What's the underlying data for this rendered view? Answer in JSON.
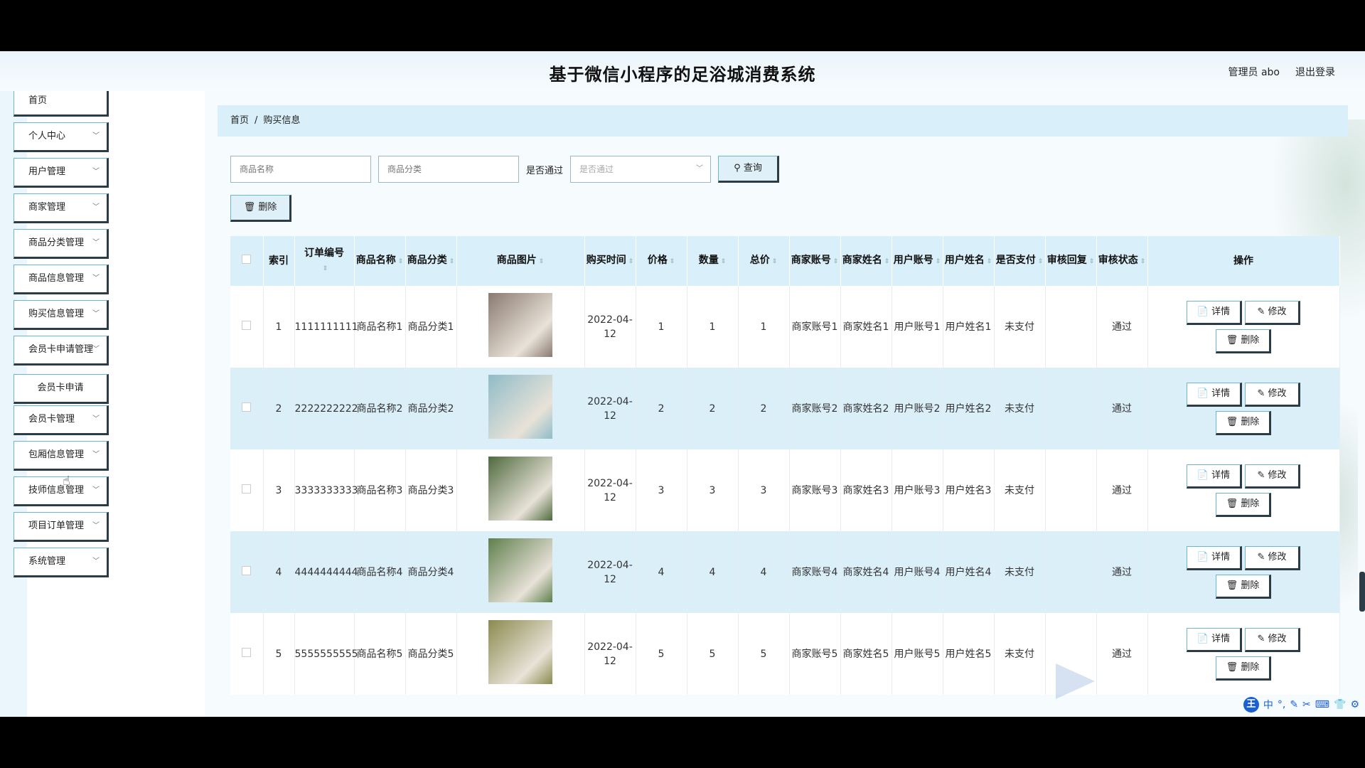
{
  "app": {
    "title": "基于微信小程序的足浴城消费系统",
    "admin_label": "管理员 abo",
    "logout_label": "退出登录"
  },
  "sidebar": {
    "items": [
      {
        "label": "首页",
        "chevron": false
      },
      {
        "label": "个人中心",
        "chevron": true
      },
      {
        "label": "用户管理",
        "chevron": true
      },
      {
        "label": "商家管理",
        "chevron": true
      },
      {
        "label": "商品分类管理",
        "chevron": true
      },
      {
        "label": "商品信息管理",
        "chevron": true
      },
      {
        "label": "购买信息管理",
        "chevron": true
      },
      {
        "label": "会员卡申请管理",
        "chevron": true
      },
      {
        "label": "会员卡申请",
        "chevron": false,
        "sub": true
      },
      {
        "label": "会员卡管理",
        "chevron": true
      },
      {
        "label": "包厢信息管理",
        "chevron": true
      },
      {
        "label": "技师信息管理",
        "chevron": true
      },
      {
        "label": "项目订单管理",
        "chevron": true
      },
      {
        "label": "系统管理",
        "chevron": true
      }
    ]
  },
  "breadcrumb": {
    "home": "首页",
    "separator": "/",
    "current": "购买信息"
  },
  "search": {
    "product_name_placeholder": "商品名称",
    "product_category_placeholder": "商品分类",
    "approved_label": "是否通过",
    "approved_select_placeholder": "是否通过",
    "query_label": "查询",
    "delete_label": "删除"
  },
  "table": {
    "headers": {
      "index": "索引",
      "order_no": "订单编号",
      "product_name": "商品名称",
      "product_category": "商品分类",
      "product_image": "商品图片",
      "purchase_time": "购买时间",
      "price": "价格",
      "quantity": "数量",
      "total": "总价",
      "merchant_account": "商家账号",
      "merchant_name": "商家姓名",
      "user_account": "用户账号",
      "user_name": "用户姓名",
      "paid": "是否支付",
      "review_reply": "审核回复",
      "review_status": "审核状态",
      "actions": "操作"
    },
    "actions": {
      "detail": "详情",
      "edit": "修改",
      "delete": "删除"
    },
    "rows": [
      {
        "index": "1",
        "order_no": "1111111111",
        "product_name": "商品名称1",
        "product_category": "商品分类1",
        "purchase_time": "2022-04-12",
        "price": "1",
        "quantity": "1",
        "total": "1",
        "merchant_account": "商家账号1",
        "merchant_name": "商家姓名1",
        "user_account": "用户账号1",
        "user_name": "用户姓名1",
        "paid": "未支付",
        "review_reply": "",
        "review_status": "通过",
        "image_color": "#8a7a70"
      },
      {
        "index": "2",
        "order_no": "2222222222",
        "product_name": "商品名称2",
        "product_category": "商品分类2",
        "purchase_time": "2022-04-12",
        "price": "2",
        "quantity": "2",
        "total": "2",
        "merchant_account": "商家账号2",
        "merchant_name": "商家姓名2",
        "user_account": "用户账号2",
        "user_name": "用户姓名2",
        "paid": "未支付",
        "review_reply": "",
        "review_status": "通过",
        "image_color": "#8fbcc8"
      },
      {
        "index": "3",
        "order_no": "3333333333",
        "product_name": "商品名称3",
        "product_category": "商品分类3",
        "purchase_time": "2022-04-12",
        "price": "3",
        "quantity": "3",
        "total": "3",
        "merchant_account": "商家账号3",
        "merchant_name": "商家姓名3",
        "user_account": "用户账号3",
        "user_name": "用户姓名3",
        "paid": "未支付",
        "review_reply": "",
        "review_status": "通过",
        "image_color": "#4f6a3e"
      },
      {
        "index": "4",
        "order_no": "4444444444",
        "product_name": "商品名称4",
        "product_category": "商品分类4",
        "purchase_time": "2022-04-12",
        "price": "4",
        "quantity": "4",
        "total": "4",
        "merchant_account": "商家账号4",
        "merchant_name": "商家姓名4",
        "user_account": "用户账号4",
        "user_name": "用户姓名4",
        "paid": "未支付",
        "review_reply": "",
        "review_status": "通过",
        "image_color": "#5f7f4c"
      },
      {
        "index": "5",
        "order_no": "5555555555",
        "product_name": "商品名称5",
        "product_category": "商品分类5",
        "purchase_time": "2022-04-12",
        "price": "5",
        "quantity": "5",
        "total": "5",
        "merchant_account": "商家账号5",
        "merchant_name": "商家姓名5",
        "user_account": "用户账号5",
        "user_name": "用户姓名5",
        "paid": "未支付",
        "review_reply": "",
        "review_status": "通过",
        "image_color": "#8b8a4e"
      }
    ]
  },
  "ime": {
    "logo": "王",
    "lang": "中"
  }
}
